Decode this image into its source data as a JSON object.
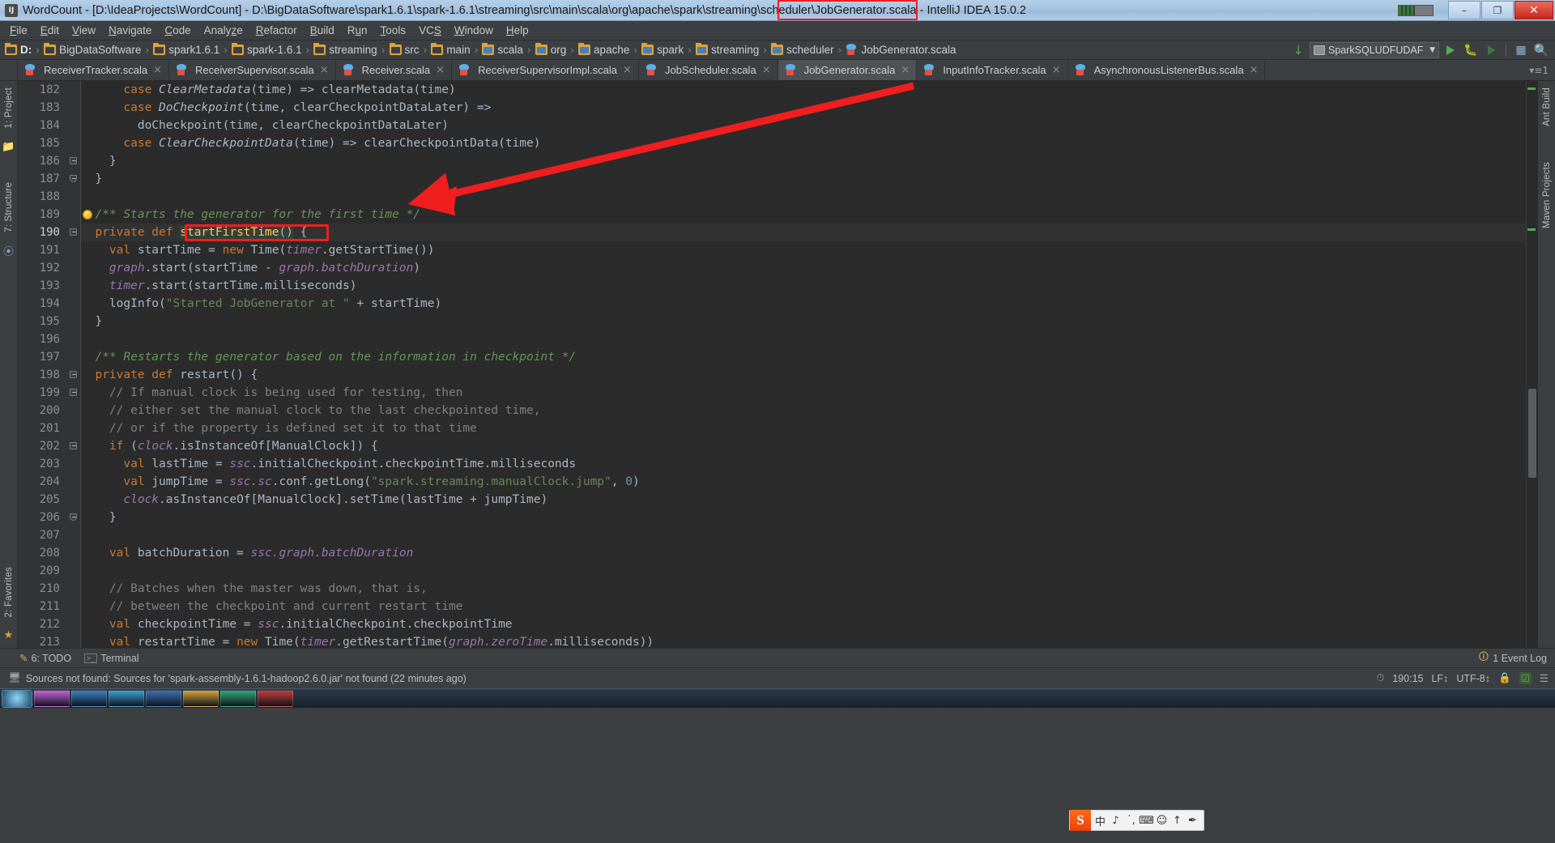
{
  "window": {
    "title": "WordCount - [D:\\IdeaProjects\\WordCount] - D:\\BigDataSoftware\\spark1.6.1\\spark-1.6.1\\streaming\\src\\main\\scala\\org\\apache\\spark\\streaming\\scheduler\\JobGenerator.scala - IntelliJ IDEA 15.0.2",
    "minimize_label": "–",
    "maximize_label": "❐",
    "close_label": "✕"
  },
  "menu": {
    "items": [
      {
        "label": "File",
        "mnemonic": "F"
      },
      {
        "label": "Edit",
        "mnemonic": "E"
      },
      {
        "label": "View",
        "mnemonic": "V"
      },
      {
        "label": "Navigate",
        "mnemonic": "N"
      },
      {
        "label": "Code",
        "mnemonic": "C"
      },
      {
        "label": "Analyze",
        "mnemonic": "z"
      },
      {
        "label": "Refactor",
        "mnemonic": "R"
      },
      {
        "label": "Build",
        "mnemonic": "B"
      },
      {
        "label": "Run",
        "mnemonic": "u"
      },
      {
        "label": "Tools",
        "mnemonic": "T"
      },
      {
        "label": "VCS",
        "mnemonic": "S"
      },
      {
        "label": "Window",
        "mnemonic": "W"
      },
      {
        "label": "Help",
        "mnemonic": "H"
      }
    ]
  },
  "breadcrumbs": {
    "items": [
      {
        "label": "D:",
        "icon": "folder-icon",
        "bold": true
      },
      {
        "label": "BigDataSoftware",
        "icon": "folder-icon",
        "bold": false
      },
      {
        "label": "spark1.6.1",
        "icon": "folder-icon",
        "bold": false
      },
      {
        "label": "spark-1.6.1",
        "icon": "folder-icon",
        "bold": false
      },
      {
        "label": "streaming",
        "icon": "folder-icon",
        "bold": false
      },
      {
        "label": "src",
        "icon": "folder-icon",
        "bold": false
      },
      {
        "label": "main",
        "icon": "folder-icon",
        "bold": false
      },
      {
        "label": "scala",
        "icon": "source-folder-icon",
        "bold": false
      },
      {
        "label": "org",
        "icon": "source-folder-icon",
        "bold": false
      },
      {
        "label": "apache",
        "icon": "source-folder-icon",
        "bold": false
      },
      {
        "label": "spark",
        "icon": "source-folder-icon",
        "bold": false
      },
      {
        "label": "streaming",
        "icon": "source-folder-icon",
        "bold": false
      },
      {
        "label": "scheduler",
        "icon": "source-folder-icon",
        "bold": false
      },
      {
        "label": "JobGenerator.scala",
        "icon": "scala-file-icon",
        "bold": false
      }
    ]
  },
  "toolbar": {
    "update_icon": "update-project-icon",
    "run_configuration": "SparkSQLUDFUDAF",
    "run_icon": "run-icon",
    "debug_icon": "debug-icon",
    "coverage_icon": "run-with-coverage-icon",
    "layout_icon": "layout-icon",
    "search_icon": "search-everywhere-icon"
  },
  "tabs": {
    "items": [
      {
        "label": "ReceiverTracker.scala",
        "active": false
      },
      {
        "label": "ReceiverSupervisor.scala",
        "active": false
      },
      {
        "label": "Receiver.scala",
        "active": false
      },
      {
        "label": "ReceiverSupervisorImpl.scala",
        "active": false
      },
      {
        "label": "JobScheduler.scala",
        "active": false
      },
      {
        "label": "JobGenerator.scala",
        "active": true
      },
      {
        "label": "InputInfoTracker.scala",
        "active": false
      },
      {
        "label": "AsynchronousListenerBus.scala",
        "active": false
      }
    ],
    "close_glyph": "×",
    "overflow_label": "1"
  },
  "left_rail": {
    "items": [
      "1: Project",
      "7: Structure",
      "2: Favorites"
    ]
  },
  "right_rail": {
    "items": [
      "Ant Build",
      "Maven Projects"
    ]
  },
  "editor": {
    "first_line": 182,
    "current_line_index": 8,
    "lines": [
      {
        "n": 182,
        "tokens": [
          {
            "t": "      ",
            "c": "plain"
          },
          {
            "t": "case ",
            "c": "kw"
          },
          {
            "t": "ClearMetadata",
            "c": "cls"
          },
          {
            "t": "(time) => clearMetadata(time)",
            "c": "plain"
          }
        ]
      },
      {
        "n": 183,
        "tokens": [
          {
            "t": "      ",
            "c": "plain"
          },
          {
            "t": "case ",
            "c": "kw"
          },
          {
            "t": "DoCheckpoint",
            "c": "cls"
          },
          {
            "t": "(time, clearCheckpointDataLater) =>",
            "c": "plain"
          }
        ]
      },
      {
        "n": 184,
        "tokens": [
          {
            "t": "        doCheckpoint(time, clearCheckpointDataLater)",
            "c": "plain"
          }
        ]
      },
      {
        "n": 185,
        "tokens": [
          {
            "t": "      ",
            "c": "plain"
          },
          {
            "t": "case ",
            "c": "kw"
          },
          {
            "t": "ClearCheckpointData",
            "c": "cls"
          },
          {
            "t": "(time) => clearCheckpointData(time)",
            "c": "plain"
          }
        ]
      },
      {
        "n": 186,
        "tokens": [
          {
            "t": "    }",
            "c": "plain"
          }
        ]
      },
      {
        "n": 187,
        "tokens": [
          {
            "t": "  }",
            "c": "plain"
          }
        ]
      },
      {
        "n": 188,
        "tokens": []
      },
      {
        "n": 189,
        "tokens": [
          {
            "t": "  /** Starts the generator for the first time */",
            "c": "doc"
          }
        ]
      },
      {
        "n": 190,
        "tokens": [
          {
            "t": "  ",
            "c": "plain"
          },
          {
            "t": "private def ",
            "c": "kw"
          },
          {
            "t": "startFirstTime",
            "c": "mth hl-ident"
          },
          {
            "t": "()",
            "c": "plain hl-ident"
          },
          {
            "t": " {",
            "c": "plain"
          }
        ]
      },
      {
        "n": 191,
        "tokens": [
          {
            "t": "    ",
            "c": "plain"
          },
          {
            "t": "val ",
            "c": "kw"
          },
          {
            "t": "startTime = ",
            "c": "plain"
          },
          {
            "t": "new ",
            "c": "kw"
          },
          {
            "t": "Time(",
            "c": "plain"
          },
          {
            "t": "timer",
            "c": "fld"
          },
          {
            "t": ".getStartTime())",
            "c": "plain"
          }
        ]
      },
      {
        "n": 192,
        "tokens": [
          {
            "t": "    ",
            "c": "plain"
          },
          {
            "t": "graph",
            "c": "fld"
          },
          {
            "t": ".start(startTime - ",
            "c": "plain"
          },
          {
            "t": "graph.batchDuration",
            "c": "fld"
          },
          {
            "t": ")",
            "c": "plain"
          }
        ]
      },
      {
        "n": 193,
        "tokens": [
          {
            "t": "    ",
            "c": "plain"
          },
          {
            "t": "timer",
            "c": "fld"
          },
          {
            "t": ".start(startTime.milliseconds)",
            "c": "plain"
          }
        ]
      },
      {
        "n": 194,
        "tokens": [
          {
            "t": "    logInfo(",
            "c": "plain"
          },
          {
            "t": "\"Started JobGenerator at \"",
            "c": "str"
          },
          {
            "t": " + startTime)",
            "c": "plain"
          }
        ]
      },
      {
        "n": 195,
        "tokens": [
          {
            "t": "  }",
            "c": "plain"
          }
        ]
      },
      {
        "n": 196,
        "tokens": []
      },
      {
        "n": 197,
        "tokens": [
          {
            "t": "  /** Restarts the generator based on the information in checkpoint */",
            "c": "doc"
          }
        ]
      },
      {
        "n": 198,
        "tokens": [
          {
            "t": "  ",
            "c": "plain"
          },
          {
            "t": "private def ",
            "c": "kw"
          },
          {
            "t": "restart",
            "c": "plain"
          },
          {
            "t": "() {",
            "c": "plain"
          }
        ]
      },
      {
        "n": 199,
        "tokens": [
          {
            "t": "    // If manual clock is being used for testing, then",
            "c": "cmt"
          }
        ]
      },
      {
        "n": 200,
        "tokens": [
          {
            "t": "    // either set the manual clock to the last checkpointed time,",
            "c": "cmt"
          }
        ]
      },
      {
        "n": 201,
        "tokens": [
          {
            "t": "    // or if the property is defined set it to that time",
            "c": "cmt"
          }
        ]
      },
      {
        "n": 202,
        "tokens": [
          {
            "t": "    ",
            "c": "plain"
          },
          {
            "t": "if ",
            "c": "kw"
          },
          {
            "t": "(",
            "c": "plain"
          },
          {
            "t": "clock",
            "c": "fld"
          },
          {
            "t": ".isInstanceOf[ManualClock]) {",
            "c": "plain"
          }
        ]
      },
      {
        "n": 203,
        "tokens": [
          {
            "t": "      ",
            "c": "plain"
          },
          {
            "t": "val ",
            "c": "kw"
          },
          {
            "t": "lastTime = ",
            "c": "plain"
          },
          {
            "t": "ssc",
            "c": "fld"
          },
          {
            "t": ".initialCheckpoint.checkpointTime.milliseconds",
            "c": "plain"
          }
        ]
      },
      {
        "n": 204,
        "tokens": [
          {
            "t": "      ",
            "c": "plain"
          },
          {
            "t": "val ",
            "c": "kw"
          },
          {
            "t": "jumpTime = ",
            "c": "plain"
          },
          {
            "t": "ssc.sc",
            "c": "fld"
          },
          {
            "t": ".conf.getLong(",
            "c": "plain"
          },
          {
            "t": "\"spark.streaming.manualClock.jump\"",
            "c": "str"
          },
          {
            "t": ", ",
            "c": "plain"
          },
          {
            "t": "0",
            "c": "num"
          },
          {
            "t": ")",
            "c": "plain"
          }
        ]
      },
      {
        "n": 205,
        "tokens": [
          {
            "t": "      ",
            "c": "plain"
          },
          {
            "t": "clock",
            "c": "fld"
          },
          {
            "t": ".asInstanceOf[ManualClock].setTime(lastTime + jumpTime)",
            "c": "plain"
          }
        ]
      },
      {
        "n": 206,
        "tokens": [
          {
            "t": "    }",
            "c": "plain"
          }
        ]
      },
      {
        "n": 207,
        "tokens": []
      },
      {
        "n": 208,
        "tokens": [
          {
            "t": "    ",
            "c": "plain"
          },
          {
            "t": "val ",
            "c": "kw"
          },
          {
            "t": "batchDuration = ",
            "c": "plain"
          },
          {
            "t": "ssc.graph.batchDuration",
            "c": "fld"
          }
        ]
      },
      {
        "n": 209,
        "tokens": []
      },
      {
        "n": 210,
        "tokens": [
          {
            "t": "    // Batches when the master was down, that is,",
            "c": "cmt"
          }
        ]
      },
      {
        "n": 211,
        "tokens": [
          {
            "t": "    // between the checkpoint and current restart time",
            "c": "cmt"
          }
        ]
      },
      {
        "n": 212,
        "tokens": [
          {
            "t": "    ",
            "c": "plain"
          },
          {
            "t": "val ",
            "c": "kw"
          },
          {
            "t": "checkpointTime = ",
            "c": "plain"
          },
          {
            "t": "ssc",
            "c": "fld"
          },
          {
            "t": ".initialCheckpoint.checkpointTime",
            "c": "plain"
          }
        ]
      },
      {
        "n": 213,
        "tokens": [
          {
            "t": "    ",
            "c": "plain"
          },
          {
            "t": "val ",
            "c": "kw"
          },
          {
            "t": "restartTime = ",
            "c": "plain"
          },
          {
            "t": "new ",
            "c": "kw"
          },
          {
            "t": "Time(",
            "c": "plain"
          },
          {
            "t": "timer",
            "c": "fld"
          },
          {
            "t": ".getRestartTime(",
            "c": "plain"
          },
          {
            "t": "graph.zeroTime",
            "c": "fld"
          },
          {
            "t": ".milliseconds))",
            "c": "plain"
          }
        ]
      }
    ]
  },
  "annotations": {
    "highlight_color": "#f01e1e",
    "tab_box": "JobGenerator.scala",
    "method_box": "startFirstTime()"
  },
  "bottom_tools": {
    "todo": "6: TODO",
    "terminal": "Terminal",
    "event_log": "1 Event Log"
  },
  "status": {
    "message": "Sources not found: Sources for 'spark-assembly-1.6.1-hadoop2.6.0.jar' not found (22 minutes ago)",
    "caret_position": "190:15",
    "line_separator": "LF↕",
    "encoding": "UTF-8↕",
    "lock_icon": "lock-icon",
    "inspection_icon": "inspections-icon",
    "memory_icon": "memory-icon"
  },
  "ime": {
    "logo": "S",
    "buttons": [
      "中",
      "♪",
      "˙,",
      "⌨",
      "☺",
      "↑",
      "✒"
    ]
  },
  "taskbar": {
    "apps": [
      {
        "color": "#c860d8"
      },
      {
        "color": "#3b7fc4"
      },
      {
        "color": "#3aa0d8"
      },
      {
        "color": "#3b6fb4"
      },
      {
        "color": "#d8a23a"
      },
      {
        "color": "#2fa878"
      },
      {
        "color": "#c83a3a"
      }
    ]
  }
}
